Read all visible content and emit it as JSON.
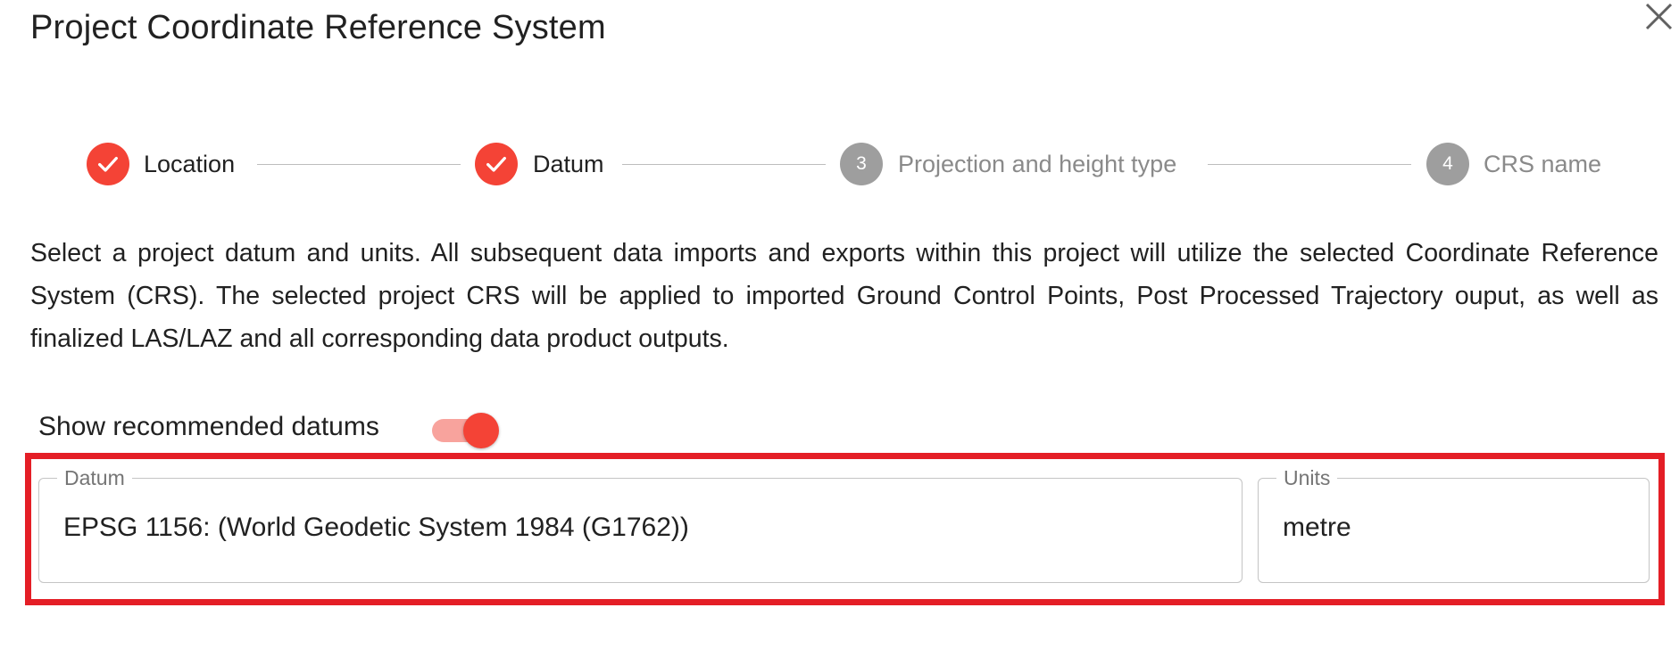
{
  "dialog": {
    "title": "Project Coordinate Reference System"
  },
  "stepper": {
    "steps": [
      {
        "number": "",
        "label": "Location",
        "status": "completed",
        "icon": "check-icon"
      },
      {
        "number": "",
        "label": "Datum",
        "status": "completed",
        "icon": "check-icon"
      },
      {
        "number": "3",
        "label": "Projection and height type",
        "status": "pending"
      },
      {
        "number": "4",
        "label": "CRS name",
        "status": "pending"
      }
    ]
  },
  "description": "Select a project datum and units. All subsequent data imports and exports within this project will utilize the selected Coordinate Reference System (CRS). The selected project CRS will be applied to imported Ground Control Points, Post Processed Trajectory ouput, as well as finalized LAS/LAZ and all corresponding data product outputs.",
  "toggle": {
    "label": "Show recommended datums",
    "checked": true
  },
  "fields": {
    "datum": {
      "label": "Datum",
      "value": "EPSG 1156: (World Geodetic System 1984 (G1762))"
    },
    "units": {
      "label": "Units",
      "value": "metre"
    }
  },
  "colors": {
    "accent": "#f44336",
    "accent_light": "#f8a39d",
    "pending": "#9e9e9e",
    "highlight_border": "#e41e26"
  }
}
